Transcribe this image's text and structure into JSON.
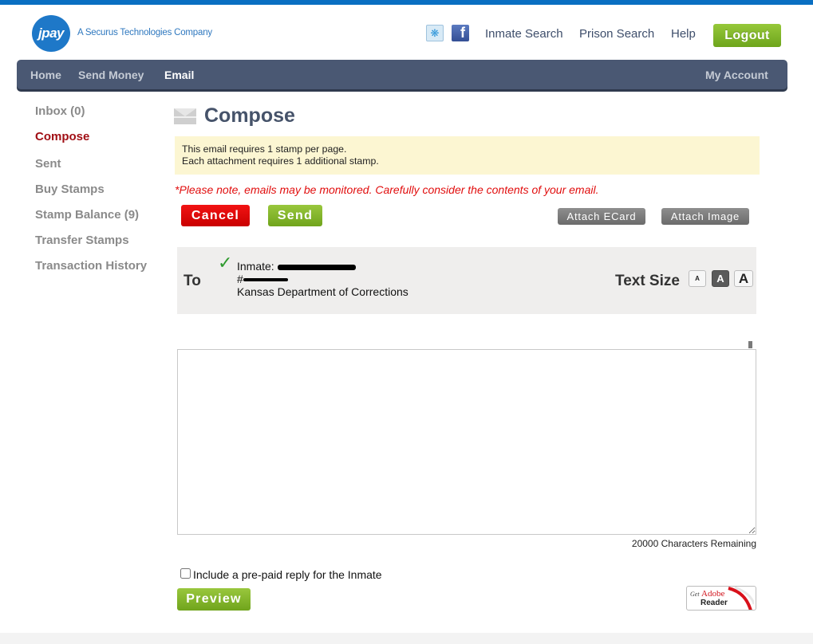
{
  "brand": {
    "logo_text": "jpay",
    "tagline": "A Securus Technologies Company",
    "colors": {
      "topbar": "#0a6fc2",
      "nav": "#4a5873",
      "active_side": "#a10f15",
      "green": "#80b429",
      "red": "#e00b0b"
    }
  },
  "header": {
    "social": [
      {
        "name": "twitter-icon",
        "glyph": "❧"
      },
      {
        "name": "facebook-icon",
        "glyph": "f"
      }
    ],
    "links": [
      "Inmate Search",
      "Prison Search",
      "Help"
    ],
    "logout_label": "Logout"
  },
  "nav": {
    "items": [
      {
        "label": "Home",
        "active": false
      },
      {
        "label": "Send Money",
        "active": false
      },
      {
        "label": "Email",
        "active": true
      }
    ],
    "account_label": "My Account"
  },
  "sidebar": {
    "items": [
      {
        "label": "Inbox (0)",
        "active": false
      },
      {
        "label": "Compose",
        "active": true
      },
      {
        "label": "Sent",
        "active": false
      },
      {
        "label": "Buy Stamps",
        "active": false
      },
      {
        "label": "Stamp Balance (9)",
        "active": false
      },
      {
        "label": "Transfer Stamps",
        "active": false
      },
      {
        "label": "Transaction History",
        "active": false
      }
    ]
  },
  "compose": {
    "title": "Compose",
    "notice_lines": [
      "This email requires 1 stamp per page.",
      "Each attachment requires 1 additional stamp."
    ],
    "monitor_warning": "*Please note, emails may be monitored. Carefully consider the contents of your email.",
    "buttons": {
      "cancel": "Cancel",
      "send": "Send",
      "attach_ecard": "Attach ECard",
      "attach_image": "Attach Image",
      "preview": "Preview"
    },
    "to": {
      "label": "To",
      "inmate_prefix": "Inmate:",
      "inmate_name": "[redacted]",
      "inmate_id_prefix": "#",
      "inmate_id": "[redacted]",
      "facility": "Kansas Department of Corrections",
      "verified": true
    },
    "text_size": {
      "label": "Text Size",
      "options": [
        "A",
        "A",
        "A"
      ],
      "selected_index": 1
    },
    "body_value": "",
    "characters_remaining": "20000 Characters Remaining",
    "prepaid_reply_label": "Include a pre-paid reply for the Inmate",
    "prepaid_reply_checked": false
  },
  "adobe_badge": {
    "get": "Get",
    "brand": "Adobe",
    "product": "Reader"
  }
}
